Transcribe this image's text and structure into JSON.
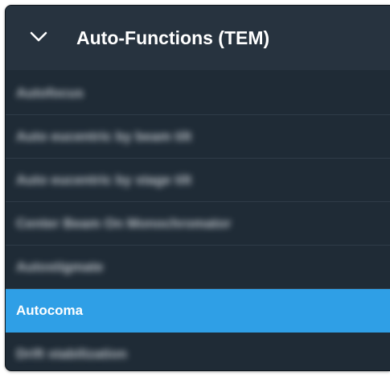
{
  "panel": {
    "title": "Auto-Functions (TEM)",
    "expanded": true,
    "chevron_icon": "chevron-down-icon",
    "colors": {
      "panel_background": "#1f2b36",
      "header_background": "#27333f",
      "selected_background": "#2f9fe6",
      "text": "#ffffff"
    },
    "items": [
      {
        "label": "Autofocus",
        "blurred": true,
        "selected": false
      },
      {
        "label": "Auto eucentric by beam tilt",
        "blurred": true,
        "selected": false
      },
      {
        "label": "Auto eucentric by stage tilt",
        "blurred": true,
        "selected": false
      },
      {
        "label": "Center Beam On Monochromator",
        "blurred": true,
        "selected": false
      },
      {
        "label": "Autostigmate",
        "blurred": true,
        "selected": false
      },
      {
        "label": "Autocoma",
        "blurred": false,
        "selected": true
      },
      {
        "label": "Drift stabilization",
        "blurred": true,
        "selected": false
      }
    ]
  }
}
